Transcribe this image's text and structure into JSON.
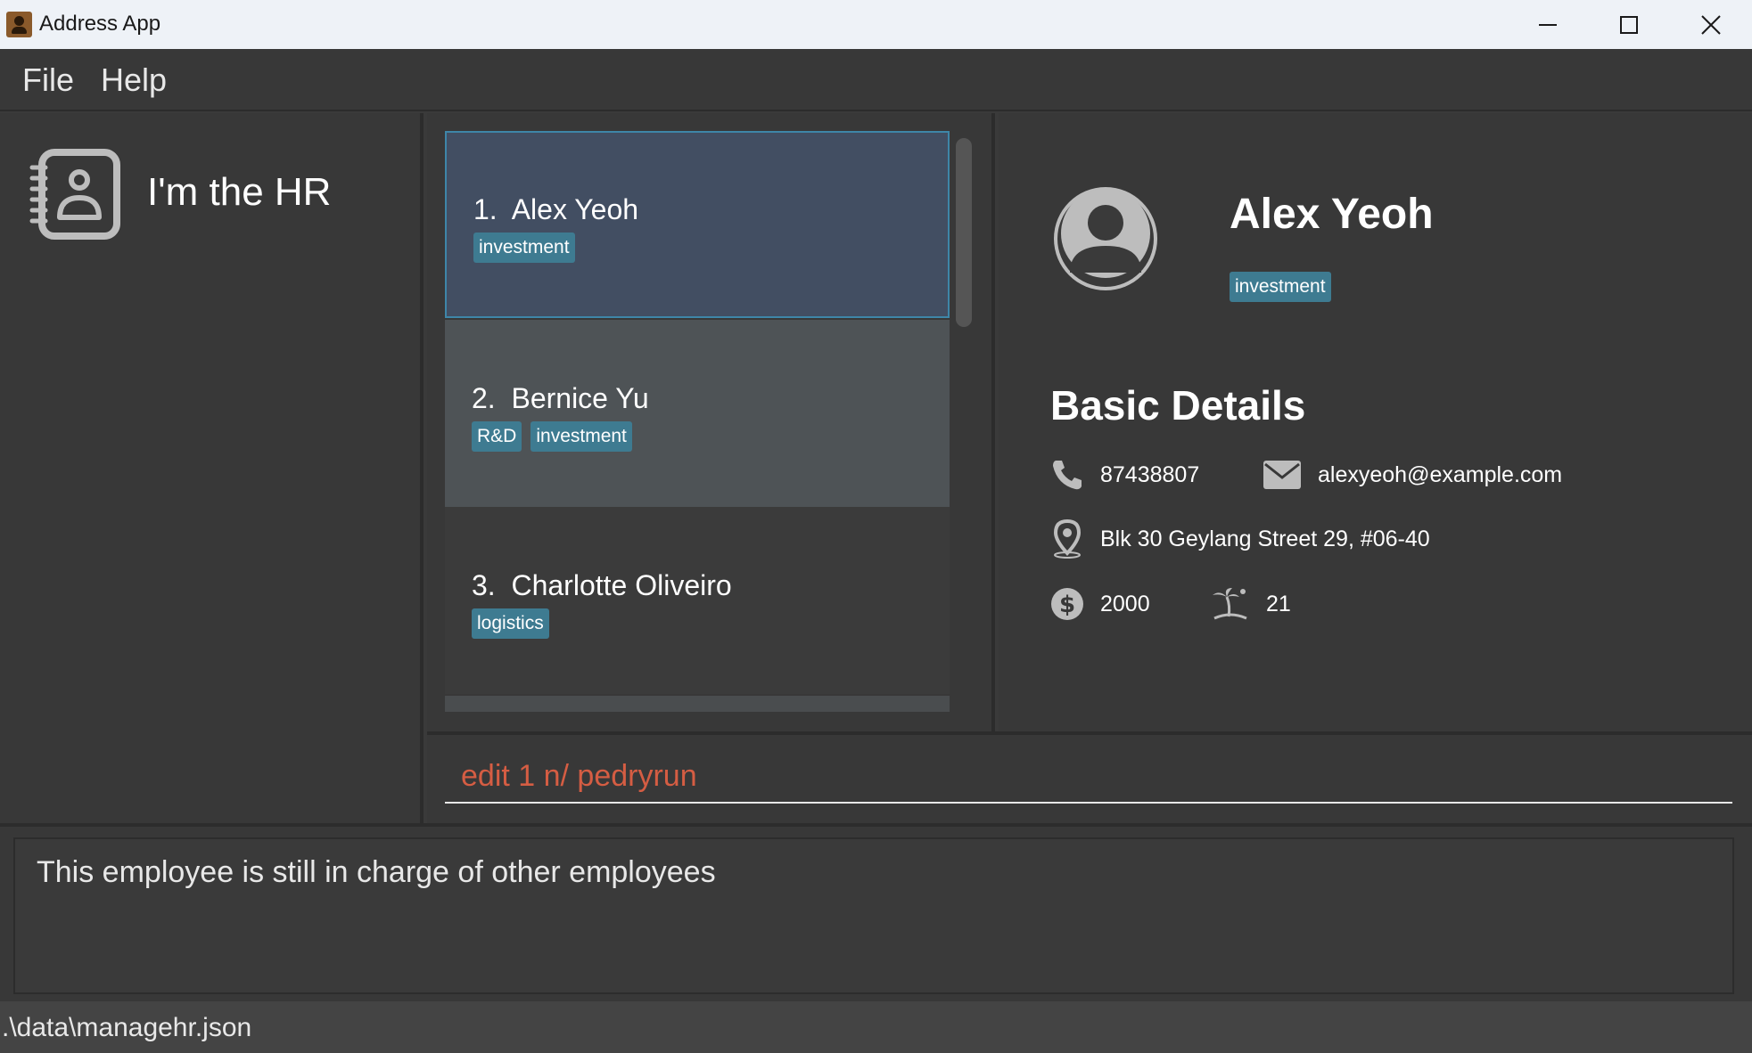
{
  "window": {
    "title": "Address App"
  },
  "menu": {
    "items": [
      "File",
      "Help"
    ]
  },
  "sidebar": {
    "title": "I'm the HR"
  },
  "persons": [
    {
      "index": "1.",
      "name": "Alex Yeoh",
      "tags": [
        "investment"
      ],
      "selected": true
    },
    {
      "index": "2.",
      "name": "Bernice Yu",
      "tags": [
        "R&D",
        "investment"
      ],
      "selected": false
    },
    {
      "index": "3.",
      "name": "Charlotte Oliveiro",
      "tags": [
        "logistics"
      ],
      "selected": false
    }
  ],
  "detail": {
    "name": "Alex Yeoh",
    "tag": "investment",
    "section_title": "Basic Details",
    "phone": "87438807",
    "email": "alexyeoh@example.com",
    "address": "Blk 30 Geylang Street 29, #06-40",
    "salary": "2000",
    "leave": "21"
  },
  "command": {
    "value": "edit 1 n/ pedryrun"
  },
  "result": {
    "text": "This employee is still in charge of other employees"
  },
  "status": {
    "path": ".\\data\\managehr.json"
  },
  "colors": {
    "background": "#383838",
    "tag": "#3e7b91",
    "selected_card": "#424e62",
    "command_text": "#d55d43"
  }
}
